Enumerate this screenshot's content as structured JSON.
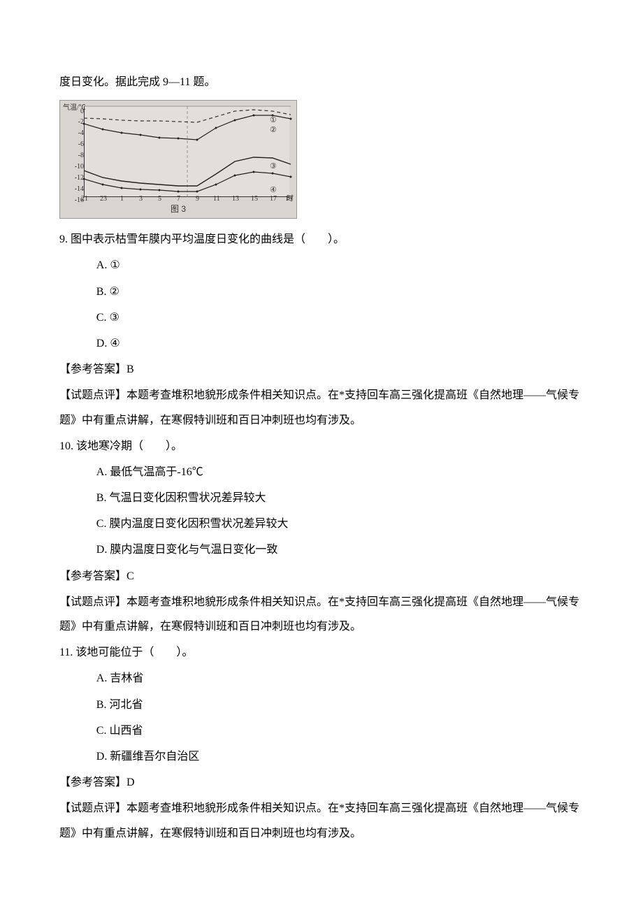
{
  "intro": "度日变化。据此完成 9—11 题。",
  "chart_data": {
    "type": "line",
    "xlabel": "时",
    "ylabel": "气温/℃",
    "ylim": [
      -16,
      0
    ],
    "x_ticks": [
      21,
      23,
      1,
      3,
      5,
      7,
      9,
      11,
      13,
      15,
      17,
      19
    ],
    "y_ticks": [
      0,
      -2,
      -4,
      -6,
      -8,
      -10,
      -12,
      -14,
      -16
    ],
    "caption": "图 3",
    "x": [
      21,
      23,
      1,
      3,
      5,
      7,
      9,
      11,
      13,
      15,
      17,
      19
    ],
    "series": [
      {
        "name": "①",
        "style": "dashed",
        "values": [
          -2.0,
          -2.2,
          -2.4,
          -2.5,
          -2.6,
          -2.7,
          -2.8,
          -1.8,
          -0.8,
          -0.6,
          -0.8,
          -1.4
        ]
      },
      {
        "name": "②",
        "style": "solid-dot",
        "values": [
          -3.0,
          -4.0,
          -4.6,
          -5.0,
          -5.4,
          -5.6,
          -5.8,
          -3.8,
          -2.4,
          -1.6,
          -1.6,
          -2.2
        ]
      },
      {
        "name": "③",
        "style": "solid",
        "values": [
          -11.2,
          -12.4,
          -13.0,
          -13.4,
          -13.6,
          -13.8,
          -13.8,
          -11.8,
          -9.6,
          -8.8,
          -9.0,
          -10.0
        ]
      },
      {
        "name": "④",
        "style": "solid-dot",
        "values": [
          -12.6,
          -13.6,
          -14.2,
          -14.4,
          -14.6,
          -14.8,
          -14.8,
          -13.6,
          -12.0,
          -11.4,
          -11.6,
          -12.2
        ]
      }
    ]
  },
  "q9": {
    "stem_prefix": "9.  ",
    "stem": "图中表示枯雪年膜内平均温度日变化的曲线是（　　）。",
    "options": {
      "a": "①",
      "b": "②",
      "c": "③",
      "d": "④"
    },
    "opt_label": {
      "a": "A.  ",
      "b": "B.  ",
      "c": "C.  ",
      "d": "D.  "
    },
    "answer_label": "【参考答案】",
    "answer": "B",
    "comment_label": "【试题点评】",
    "comment": "本题考查堆积地貌形成条件相关知识点。在*支持回车高三强化提高班《自然地理——气候专题》中有重点讲解，在寒假特训班和百日冲刺班也均有涉及。"
  },
  "q10": {
    "stem_prefix": "10.  ",
    "stem": "该地寒冷期（　　）。",
    "options": {
      "a": "最低气温高于-16℃",
      "b": "气温日变化因积雪状况差异较大",
      "c": "膜内温度日变化因积雪状况差异较大",
      "d": "膜内温度日变化与气温日变化一致"
    },
    "opt_label": {
      "a": "A.  ",
      "b": "B.  ",
      "c": "C.  ",
      "d": "D.  "
    },
    "answer_label": "【参考答案】",
    "answer": "C",
    "comment_label": "【试题点评】",
    "comment": "本题考查堆积地貌形成条件相关知识点。在*支持回车高三强化提高班《自然地理——气候专题》中有重点讲解，在寒假特训班和百日冲刺班也均有涉及。"
  },
  "q11": {
    "stem_prefix": "11.  ",
    "stem": "该地可能位于（　　）。",
    "options": {
      "a": "吉林省",
      "b": "河北省",
      "c": "山西省",
      "d": "新疆维吾尔自治区"
    },
    "opt_label": {
      "a": "A.  ",
      "b": "B.  ",
      "c": "C.  ",
      "d": "D.  "
    },
    "answer_label": "【参考答案】",
    "answer": "D",
    "comment_label": "【试题点评】",
    "comment": "本题考查堆积地貌形成条件相关知识点。在*支持回车高三强化提高班《自然地理——气候专题》中有重点讲解，在寒假特训班和百日冲刺班也均有涉及。"
  }
}
